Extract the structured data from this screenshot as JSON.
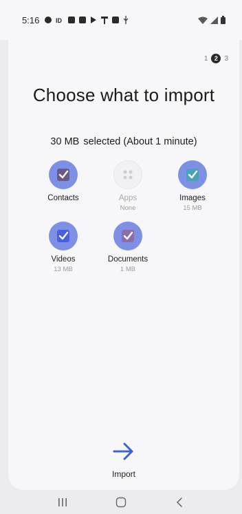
{
  "status_bar": {
    "time": "5:16",
    "left_icons": [
      "vpn-key-icon",
      "id-badge-icon",
      "newspaper-icon",
      "gallery-icon",
      "play-store-icon",
      "t-mobile-icon",
      "calendar-icon",
      "usb-icon"
    ],
    "right_icons": [
      "wifi-icon",
      "signal-icon",
      "battery-icon"
    ]
  },
  "pager": {
    "steps": [
      "1",
      "2",
      "3"
    ],
    "current": "2"
  },
  "title": "Choose what to import",
  "summary": {
    "size": "30 MB",
    "text": "selected (About 1 minute)"
  },
  "items": [
    {
      "label": "Contacts",
      "sub": "",
      "checked": true,
      "enabled": true
    },
    {
      "label": "Apps",
      "sub": "None",
      "checked": false,
      "enabled": false
    },
    {
      "label": "Images",
      "sub": "15 MB",
      "checked": true,
      "enabled": true
    },
    {
      "label": "Videos",
      "sub": "13 MB",
      "checked": true,
      "enabled": true
    },
    {
      "label": "Documents",
      "sub": "1 MB",
      "checked": true,
      "enabled": true
    }
  ],
  "import": {
    "label": "Import"
  },
  "colors": {
    "accent": "#3b63d8",
    "item_bg": "#7d90e5",
    "background": "#f7f7f9"
  },
  "nav": [
    "recents-icon",
    "home-icon",
    "back-icon"
  ]
}
